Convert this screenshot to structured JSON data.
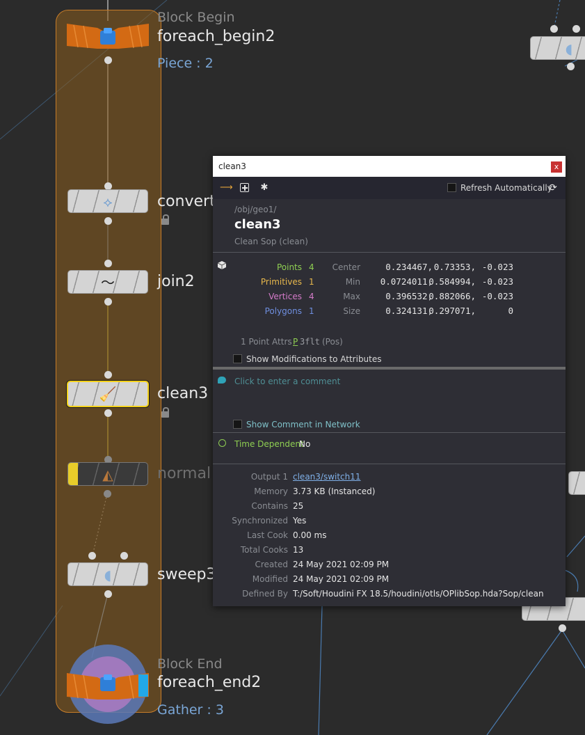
{
  "network": {
    "block_begin": {
      "title": "Block Begin",
      "name": "foreach_begin2",
      "sub": "Piece : 2"
    },
    "nodes": {
      "convert": "convert",
      "join": "join2",
      "clean": "clean3",
      "normal": "normal",
      "sweep": "sweep3"
    },
    "block_end": {
      "title": "Block End",
      "name": "foreach_end2",
      "sub": "Gather : 3"
    }
  },
  "info_window": {
    "title": "clean3",
    "close": "x",
    "refresh_label": "Refresh Automatically",
    "path": "/obj/geo1/",
    "node_name": "clean3",
    "node_type": "Clean Sop (clean)",
    "stats": [
      {
        "label": "Points",
        "count": "4",
        "color": "#8fcf52"
      },
      {
        "label": "Primitives",
        "count": "1",
        "color": "#e8b84c"
      },
      {
        "label": "Vertices",
        "count": "4",
        "color": "#d47bc9"
      },
      {
        "label": "Polygons",
        "count": "1",
        "color": "#6f8fe0"
      }
    ],
    "bounds": [
      {
        "label": "Center",
        "x": "0.234467,",
        "y": "0.73353,",
        "z": "-0.023"
      },
      {
        "label": "Min",
        "x": "0.0724011,",
        "y": "0.584994,",
        "z": "-0.023"
      },
      {
        "label": "Max",
        "x": "0.396532,",
        "y": "0.882066,",
        "z": "-0.023"
      },
      {
        "label": "Size",
        "x": "0.324131,",
        "y": "0.297071,",
        "z": "0"
      }
    ],
    "attrs_label": "1 Point Attrs",
    "attr_class": "P",
    "attr_type": "3flt",
    "attr_name": "(Pos)",
    "show_mods_label": "Show Modifications to Attributes",
    "comment_placeholder": "Click to enter a comment",
    "show_comment_label": "Show Comment in Network",
    "time_dep_label": "Time Dependent",
    "time_dep_value": "No",
    "details": [
      {
        "key": "Output 1",
        "value": "clean3/switch11",
        "link": true
      },
      {
        "key": "Memory",
        "value": "3.73 KB (Instanced)"
      },
      {
        "key": "Contains",
        "value": "25"
      },
      {
        "key": "Synchronized",
        "value": "Yes"
      },
      {
        "key": "Last Cook",
        "value": "0.00 ms"
      },
      {
        "key": "Total Cooks",
        "value": "13"
      },
      {
        "key": "Created",
        "value": "24 May 2021 02:09 PM"
      },
      {
        "key": "Modified",
        "value": "24 May 2021 02:09 PM"
      },
      {
        "key": "Defined By",
        "value": "T:/Soft/Houdini FX 18.5/houdini/otls/OPlibSop.hda?Sop/clean"
      }
    ]
  }
}
